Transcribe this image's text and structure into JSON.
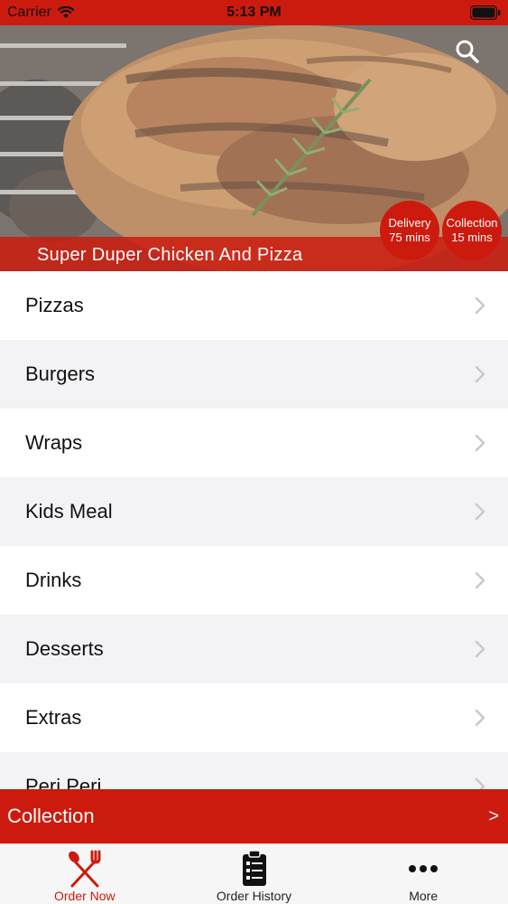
{
  "status_bar": {
    "carrier": "Carrier",
    "time": "5:13 PM"
  },
  "colors": {
    "brand_red": "#cc1b0e",
    "row_alt": "#f3f3f6",
    "chevron": "#c7c7cc"
  },
  "hero": {
    "title": "Super Duper Chicken And Pizza",
    "search_icon": "search-icon",
    "delivery": {
      "label": "Delivery",
      "time": "75 mins"
    },
    "collection": {
      "label": "Collection",
      "time": "15 mins"
    }
  },
  "menu": {
    "categories": [
      {
        "label": "Pizzas"
      },
      {
        "label": "Burgers"
      },
      {
        "label": "Wraps"
      },
      {
        "label": "Kids Meal"
      },
      {
        "label": "Drinks"
      },
      {
        "label": "Desserts"
      },
      {
        "label": "Extras"
      },
      {
        "label": "Peri Peri"
      }
    ]
  },
  "collection_bar": {
    "label": "Collection",
    "arrow": ">"
  },
  "tabs": [
    {
      "label": "Order Now",
      "icon": "fork-knife-icon",
      "active": true
    },
    {
      "label": "Order History",
      "icon": "clipboard-list-icon",
      "active": false
    },
    {
      "label": "More",
      "icon": "more-dots-icon",
      "active": false
    }
  ]
}
